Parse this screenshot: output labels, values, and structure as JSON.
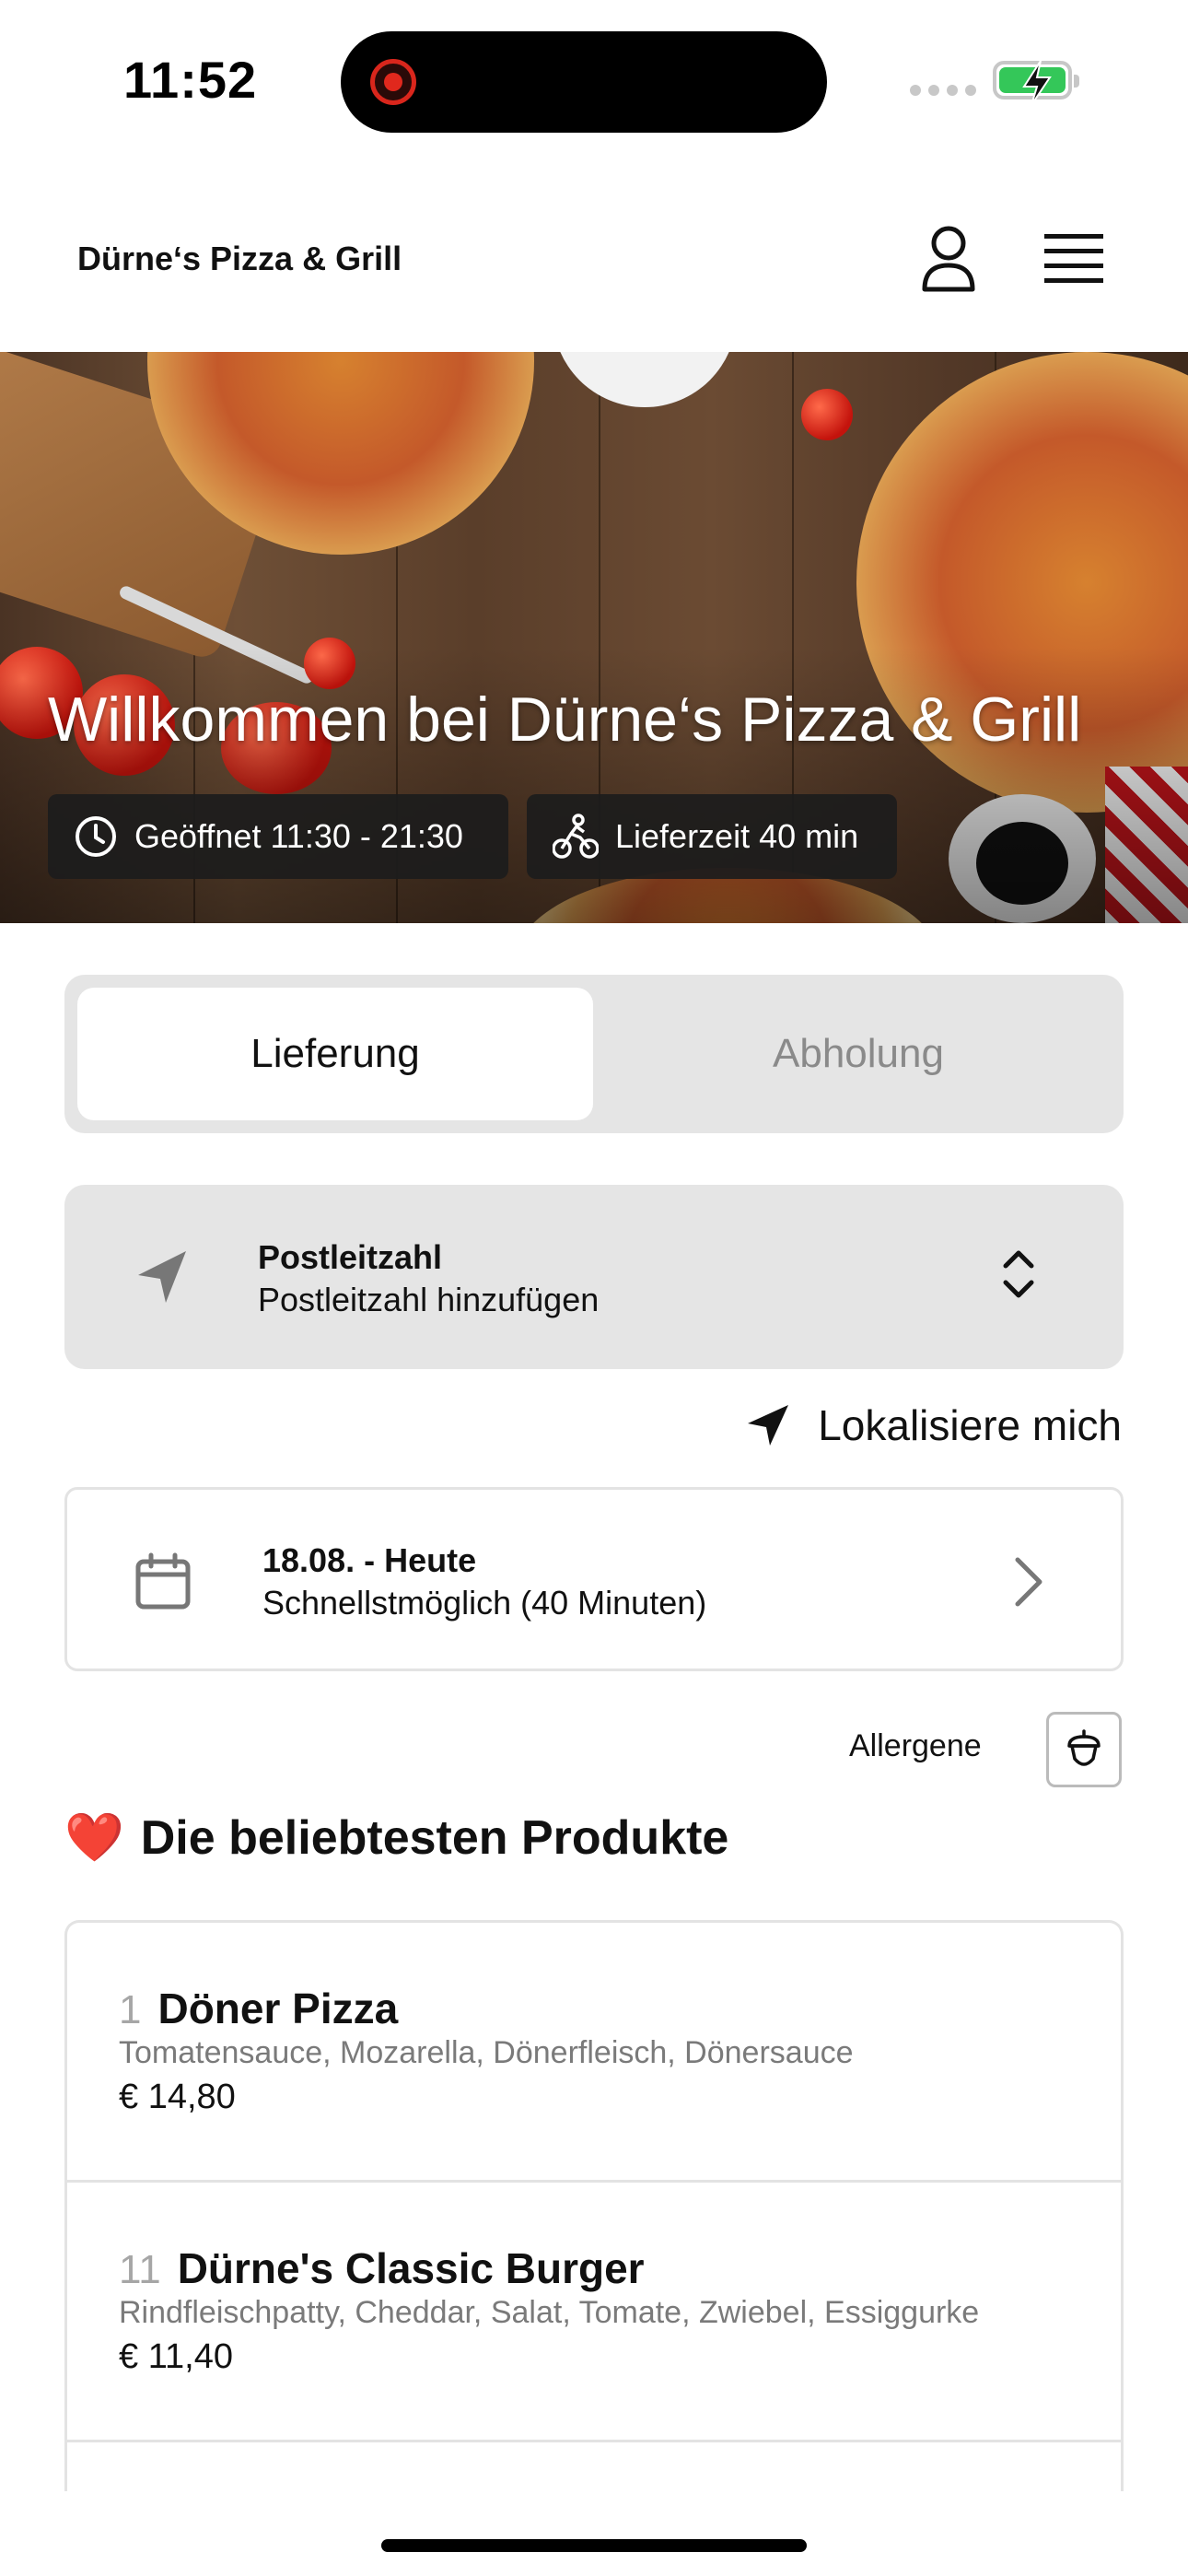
{
  "status_bar": {
    "time": "11:52"
  },
  "header": {
    "brand": "Dürne‘s Pizza & Grill"
  },
  "hero": {
    "title": "Willkommen bei Dürne‘s Pizza & Grill",
    "opening_hours": "Geöffnet 11:30 - 21:30",
    "delivery_time": "Lieferzeit 40 min"
  },
  "mode_toggle": {
    "delivery": "Lieferung",
    "pickup": "Abholung",
    "selected": "Lieferung"
  },
  "postal": {
    "label": "Postleitzahl",
    "placeholder": "Postleitzahl hinzufügen"
  },
  "locate": {
    "label": "Lokalisiere mich"
  },
  "schedule": {
    "date": "18.08. - Heute",
    "time": "Schnellstmöglich (40 Minuten)"
  },
  "allergene": {
    "label": "Allergene"
  },
  "popular": {
    "emoji": "❤️",
    "title": "Die beliebtesten Produkte",
    "items": [
      {
        "number": "1",
        "name": "Döner Pizza",
        "description": "Tomatensauce, Mozarella, Dönerfleisch, Dönersauce",
        "price": "€ 14,80"
      },
      {
        "number": "11",
        "name": "Dürne's Classic Burger",
        "description": "Rindfleischpatty, Cheddar, Salat, Tomate, Zwiebel, Essiggurke",
        "price": "€ 11,40"
      }
    ]
  },
  "colors": {
    "accent_battery": "#34c759",
    "recording": "#e0281d",
    "panel_bg": "#e5e5e5"
  }
}
